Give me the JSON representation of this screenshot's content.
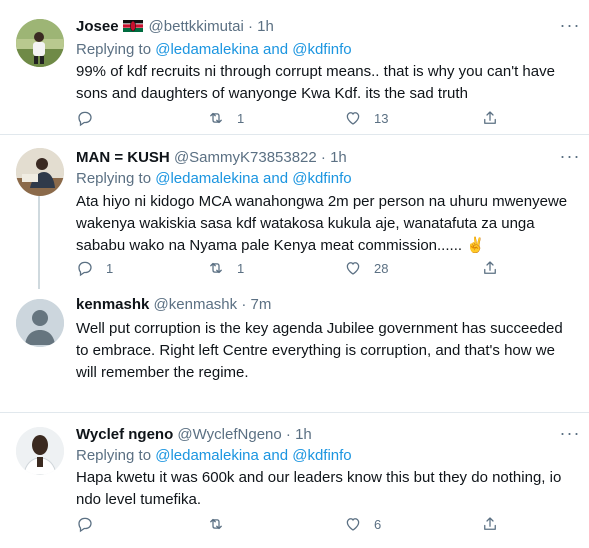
{
  "tweets": [
    {
      "name": "Josee",
      "handle": "@bettkkimutai",
      "time": "1h",
      "reply_prefix": "Replying to",
      "mention1": "@ledamalekina",
      "and": "and",
      "mention2": "@kdfinfo",
      "text": "99% of kdf recruits ni through corrupt means.. that is why you can't have sons and daughters  of wanyonge Kwa Kdf. its the sad truth",
      "replies": "",
      "retweets": "1",
      "likes": "13"
    },
    {
      "name": "MAN = KUSH",
      "handle": "@SammyK73853822",
      "time": "1h",
      "reply_prefix": "Replying to",
      "mention1": "@ledamalekina",
      "and": "and",
      "mention2": "@kdfinfo",
      "text": "Ata hiyo ni kidogo MCA wanahongwa 2m per person na uhuru mwenyewe wakenya wakiskia sasa kdf watakosa kukula aje, wanatafuta za unga sababu wako na Nyama pale Kenya meat commission...... ✌",
      "replies": "1",
      "retweets": "1",
      "likes": "28"
    },
    {
      "name": "kenmashk",
      "handle": "@kenmashk",
      "time": "7m",
      "text": "Well put corruption is the key agenda Jubilee government has succeeded to embrace. Right left Centre everything is corruption, and that's how we will remember the regime."
    },
    {
      "name": "Wyclef ngeno",
      "handle": "@WyclefNgeno",
      "time": "1h",
      "reply_prefix": "Replying to",
      "mention1": "@ledamalekina",
      "and": "and",
      "mention2": "@kdfinfo",
      "text": "Hapa kwetu it was 600k and our leaders know this but they do nothing, io ndo level tumefika.",
      "replies": "",
      "retweets": "",
      "likes": "6"
    }
  ],
  "separator": "·",
  "icons": [
    "kenya-flag-icon",
    "more-icon",
    "reply-icon",
    "retweet-icon",
    "like-icon",
    "share-icon",
    "avatar-placeholder-icon"
  ],
  "colors": {
    "secondary_text": "#5b7083",
    "link": "#1b95e0",
    "divider": "#e1e8ed",
    "thread_line": "#cfd9de"
  }
}
